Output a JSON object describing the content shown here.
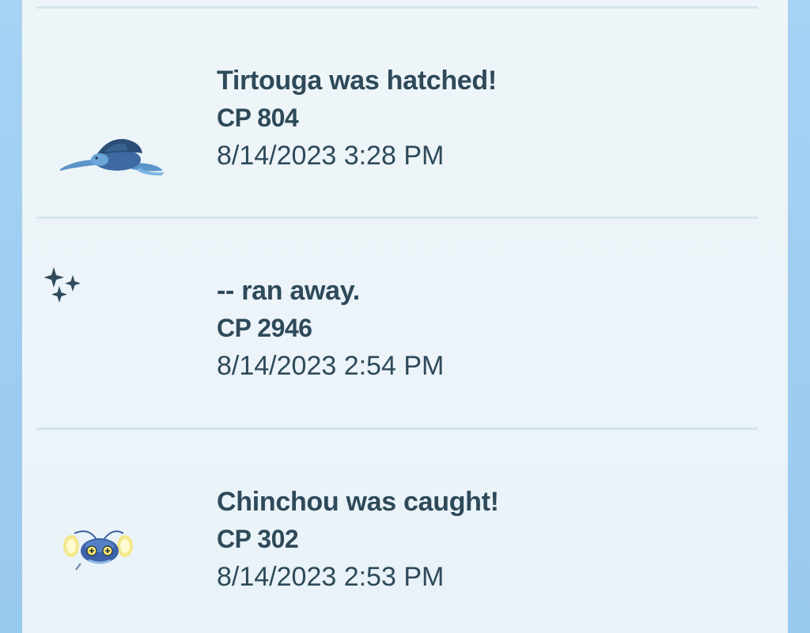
{
  "entries": [
    {
      "title": "Tirtouga was hatched!",
      "cp": "CP 804",
      "time": "8/14/2023 3:28 PM",
      "icon": "tirtouga-sprite-icon"
    },
    {
      "title": "-- ran away.",
      "cp": "CP 2946",
      "time": "8/14/2023 2:54 PM",
      "icon": "sparkles-icon"
    },
    {
      "title": "Chinchou was caught!",
      "cp": "CP 302",
      "time": "8/14/2023 2:53 PM",
      "icon": "chinchou-sprite-icon"
    }
  ],
  "colors": {
    "text": "#2e4a5a",
    "panel_bg": "#eef5f8",
    "side_bg": "#a6d2f4",
    "divider": "#d5e4ec"
  }
}
